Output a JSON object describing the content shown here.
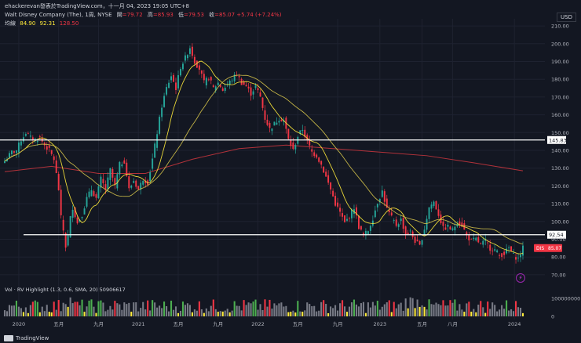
{
  "header": {
    "line1": "ehackerevan發表於TradingView.com，十一月 04, 2023 19:05 UTC+8",
    "line2_prefix": "Walt Disney Company (The), 1周, NYSE",
    "open_label": "開",
    "open_value": "=79.72",
    "high_label": "高",
    "high_value": "=85.93",
    "low_label": "低",
    "low_value": "=79.53",
    "close_label": "收",
    "close_value": "=85.07 +5.74 (+7.24%)",
    "ma_label": "均線",
    "ma_values": [
      "84.90",
      "92.31",
      "128.50"
    ],
    "ma_colors": [
      "#ffeb3b",
      "#ffeb3b",
      "#f23645"
    ]
  },
  "currency": "USD",
  "volume_header": "Vol · RV Highlight (1.3, 0.6, SMA, 20)  50906617",
  "brand": "TradingView",
  "colors": {
    "background": "#131722",
    "up": "#26a69a",
    "up_bar": "#4caf50",
    "down": "#f23645",
    "grid": "#1e2230",
    "ma_short": "#ffeb3b",
    "ma_mid": "#d4c24a",
    "ma_long": "#b2323a",
    "hline": "#ffffff",
    "vol_normal": "#787b86",
    "vol_high_up": "#4caf50",
    "vol_high_down": "#f23645",
    "vol_low": "#ffeb3b"
  },
  "chart_data": {
    "type": "candlestick",
    "symbol": "DIS",
    "timeframe": "1周",
    "y_ticks": [
      "210.00",
      "200.00",
      "190.00",
      "180.00",
      "170.00",
      "160.00",
      "150.00",
      "140.00",
      "130.00",
      "120.00",
      "110.00",
      "100.00",
      "90.00",
      "80.00",
      "70.00"
    ],
    "ylim": [
      66,
      214
    ],
    "x_ticks": [
      "2020",
      "五月",
      "九月",
      "2021",
      "五月",
      "九月",
      "2022",
      "五月",
      "九月",
      "2023",
      "五月",
      "八月",
      "2024"
    ],
    "volume_ticks": [
      "100000000",
      "0"
    ],
    "horizontal_lines": [
      {
        "label": "145.83",
        "value": 145.83
      },
      {
        "label": "92.54",
        "value": 92.54
      }
    ],
    "last_price_label": {
      "symbol": "DIS",
      "value": "85.07"
    },
    "close_series": [
      {
        "t": 0,
        "c": 134
      },
      {
        "t": 3,
        "c": 139
      },
      {
        "t": 5,
        "c": 140
      },
      {
        "t": 7,
        "c": 146
      },
      {
        "t": 9,
        "c": 150
      },
      {
        "t": 11,
        "c": 147
      },
      {
        "t": 13,
        "c": 146
      },
      {
        "t": 15,
        "c": 147
      },
      {
        "t": 17,
        "c": 143
      },
      {
        "t": 19,
        "c": 140
      },
      {
        "t": 21,
        "c": 135
      },
      {
        "t": 23,
        "c": 118
      },
      {
        "t": 24,
        "c": 102
      },
      {
        "t": 25,
        "c": 95
      },
      {
        "t": 26,
        "c": 86
      },
      {
        "t": 27,
        "c": 92
      },
      {
        "t": 28,
        "c": 102
      },
      {
        "t": 29,
        "c": 108
      },
      {
        "t": 31,
        "c": 99
      },
      {
        "t": 33,
        "c": 104
      },
      {
        "t": 35,
        "c": 113
      },
      {
        "t": 37,
        "c": 118
      },
      {
        "t": 39,
        "c": 113
      },
      {
        "t": 41,
        "c": 124
      },
      {
        "t": 43,
        "c": 118
      },
      {
        "t": 45,
        "c": 129
      },
      {
        "t": 47,
        "c": 120
      },
      {
        "t": 49,
        "c": 132
      },
      {
        "t": 51,
        "c": 134
      },
      {
        "t": 53,
        "c": 118
      },
      {
        "t": 55,
        "c": 123
      },
      {
        "t": 57,
        "c": 118
      },
      {
        "t": 59,
        "c": 124
      },
      {
        "t": 61,
        "c": 122
      },
      {
        "t": 63,
        "c": 135
      },
      {
        "t": 65,
        "c": 150
      },
      {
        "t": 67,
        "c": 165
      },
      {
        "t": 69,
        "c": 175
      },
      {
        "t": 71,
        "c": 182
      },
      {
        "t": 73,
        "c": 175
      },
      {
        "t": 75,
        "c": 187
      },
      {
        "t": 77,
        "c": 192
      },
      {
        "t": 79,
        "c": 198
      },
      {
        "t": 81,
        "c": 190
      },
      {
        "t": 83,
        "c": 186
      },
      {
        "t": 85,
        "c": 178
      },
      {
        "t": 87,
        "c": 181
      },
      {
        "t": 89,
        "c": 175
      },
      {
        "t": 91,
        "c": 178
      },
      {
        "t": 93,
        "c": 174
      },
      {
        "t": 95,
        "c": 177
      },
      {
        "t": 97,
        "c": 180
      },
      {
        "t": 99,
        "c": 183
      },
      {
        "t": 101,
        "c": 178
      },
      {
        "t": 103,
        "c": 176
      },
      {
        "t": 105,
        "c": 172
      },
      {
        "t": 107,
        "c": 176
      },
      {
        "t": 109,
        "c": 170
      },
      {
        "t": 111,
        "c": 158
      },
      {
        "t": 113,
        "c": 152
      },
      {
        "t": 115,
        "c": 155
      },
      {
        "t": 117,
        "c": 158
      },
      {
        "t": 119,
        "c": 157
      },
      {
        "t": 121,
        "c": 146
      },
      {
        "t": 123,
        "c": 140
      },
      {
        "t": 125,
        "c": 148
      },
      {
        "t": 127,
        "c": 152
      },
      {
        "t": 129,
        "c": 145
      },
      {
        "t": 131,
        "c": 139
      },
      {
        "t": 133,
        "c": 137
      },
      {
        "t": 135,
        "c": 132
      },
      {
        "t": 137,
        "c": 125
      },
      {
        "t": 139,
        "c": 118
      },
      {
        "t": 141,
        "c": 110
      },
      {
        "t": 143,
        "c": 105
      },
      {
        "t": 145,
        "c": 99
      },
      {
        "t": 147,
        "c": 103
      },
      {
        "t": 149,
        "c": 108
      },
      {
        "t": 151,
        "c": 97
      },
      {
        "t": 153,
        "c": 92
      },
      {
        "t": 155,
        "c": 95
      },
      {
        "t": 157,
        "c": 102
      },
      {
        "t": 159,
        "c": 111
      },
      {
        "t": 161,
        "c": 117
      },
      {
        "t": 163,
        "c": 107
      },
      {
        "t": 165,
        "c": 102
      },
      {
        "t": 167,
        "c": 98
      },
      {
        "t": 169,
        "c": 101
      },
      {
        "t": 171,
        "c": 93
      },
      {
        "t": 173,
        "c": 94
      },
      {
        "t": 175,
        "c": 89
      },
      {
        "t": 177,
        "c": 86
      },
      {
        "t": 179,
        "c": 96
      },
      {
        "t": 181,
        "c": 108
      },
      {
        "t": 183,
        "c": 111
      },
      {
        "t": 185,
        "c": 104
      },
      {
        "t": 187,
        "c": 96
      },
      {
        "t": 189,
        "c": 97
      },
      {
        "t": 191,
        "c": 95
      },
      {
        "t": 193,
        "c": 100
      },
      {
        "t": 195,
        "c": 98
      },
      {
        "t": 197,
        "c": 92
      },
      {
        "t": 199,
        "c": 89
      },
      {
        "t": 201,
        "c": 90
      },
      {
        "t": 203,
        "c": 87
      },
      {
        "t": 205,
        "c": 89
      },
      {
        "t": 207,
        "c": 85
      },
      {
        "t": 209,
        "c": 84
      },
      {
        "t": 211,
        "c": 81
      },
      {
        "t": 213,
        "c": 82
      },
      {
        "t": 215,
        "c": 85
      },
      {
        "t": 217,
        "c": 81
      },
      {
        "t": 219,
        "c": 79
      },
      {
        "t": 221,
        "c": 85.07
      }
    ],
    "ma_long_series": [
      {
        "t": 0,
        "c": 128
      },
      {
        "t": 20,
        "c": 131
      },
      {
        "t": 40,
        "c": 127
      },
      {
        "t": 60,
        "c": 127
      },
      {
        "t": 80,
        "c": 135
      },
      {
        "t": 100,
        "c": 141
      },
      {
        "t": 120,
        "c": 143
      },
      {
        "t": 140,
        "c": 141
      },
      {
        "t": 160,
        "c": 139
      },
      {
        "t": 180,
        "c": 137
      },
      {
        "t": 200,
        "c": 133
      },
      {
        "t": 221,
        "c": 128.5
      }
    ]
  }
}
